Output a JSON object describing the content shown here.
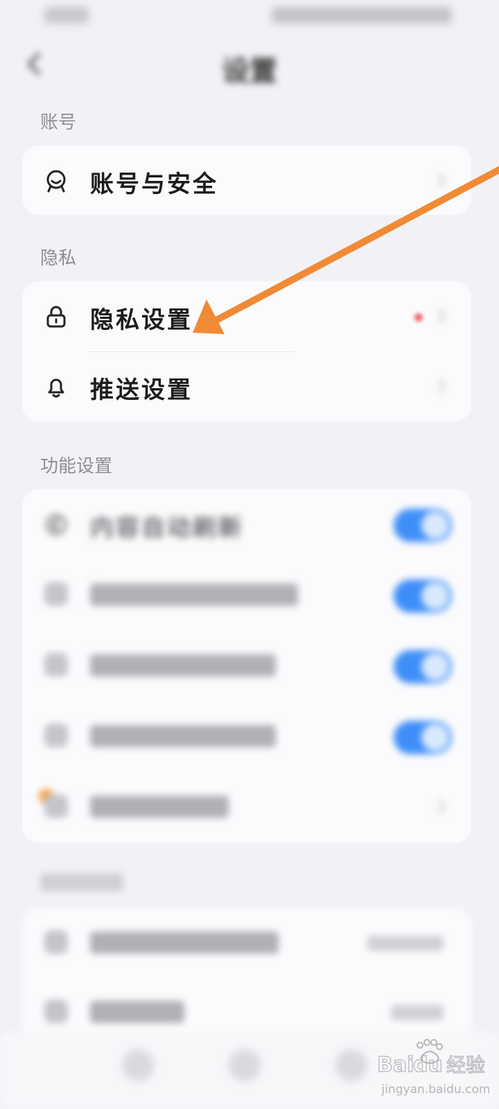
{
  "header": {
    "title": "设置"
  },
  "sections": {
    "account": {
      "label": "账号",
      "items": [
        {
          "label": "账号与安全",
          "icon": "account-icon"
        }
      ]
    },
    "privacy": {
      "label": "隐私",
      "items": [
        {
          "label": "隐私设置",
          "icon": "lock-icon",
          "badge_color": "#f16570"
        },
        {
          "label": "推送设置",
          "icon": "bell-icon"
        }
      ]
    },
    "features": {
      "label": "功能设置",
      "items": [
        {
          "label": "内容自动刷新",
          "icon": "auto-refresh-icon",
          "toggle_on": true
        }
      ]
    }
  },
  "annotation": {
    "arrow_color": "#f08a35"
  },
  "watermark": {
    "brand": "Baidu经验",
    "url": "jingyan.baidu.com"
  },
  "colors": {
    "accent": "#3f8ef8",
    "background": "#f2f2f6",
    "card": "#fbfbfd"
  }
}
